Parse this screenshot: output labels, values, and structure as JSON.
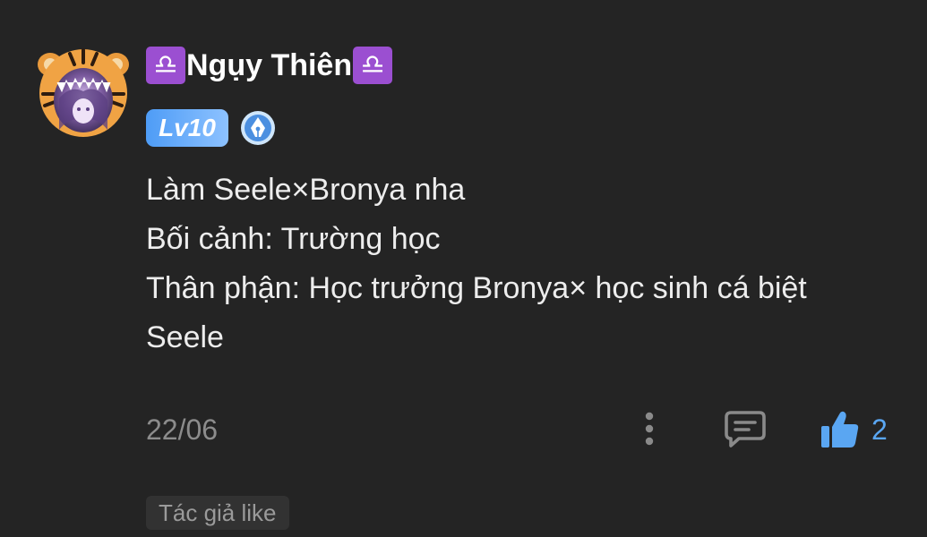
{
  "comment": {
    "user": {
      "name": "Ngụy Thiên",
      "name_prefix_symbol": "♎",
      "name_suffix_symbol": "♎",
      "level_badge": "Lv10",
      "avatar_icon": "tiger-hood-avatar",
      "extra_badge_icon": "fountain-pen-icon"
    },
    "content_lines": [
      "Làm Seele×Bronya nha",
      "Bối cảnh: Trường học",
      "Thân phận: Học trưởng Bronya× học sinh cá biệt",
      "Seele"
    ],
    "date": "22/06",
    "actions": {
      "more_icon": "more-vertical-icon",
      "reply_icon": "comment-icon",
      "like_icon": "thumbs-up-icon",
      "like_count": "2"
    },
    "author_like_tag": "Tác giả like"
  },
  "colors": {
    "background": "#242424",
    "accent_blue": "#5aa6f2",
    "libra_purple": "#9b4fd1",
    "muted_text": "#8c8c8c"
  }
}
